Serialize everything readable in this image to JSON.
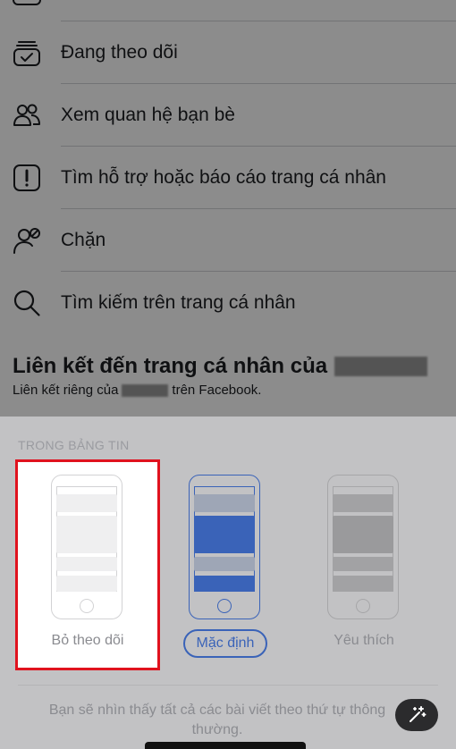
{
  "menu": {
    "items": [
      {
        "label": "Đang theo dõi",
        "icon": "following-icon"
      },
      {
        "label": "Xem quan hệ bạn bè",
        "icon": "friends-icon"
      },
      {
        "label": "Tìm hỗ trợ hoặc báo cáo trang cá nhân",
        "icon": "report-icon"
      },
      {
        "label": "Chặn",
        "icon": "block-user-icon"
      },
      {
        "label": "Tìm kiếm trên trang cá nhân",
        "icon": "search-icon"
      }
    ]
  },
  "link_section": {
    "title": "Liên kết đến trang cá nhân của",
    "subtitle_prefix": "Liên kết riêng của",
    "subtitle_suffix": "trên Facebook."
  },
  "sheet": {
    "section_label": "TRONG BẢNG TIN",
    "options": [
      {
        "label": "Bỏ theo dõi",
        "selected_box": true
      },
      {
        "label": "Mặc định",
        "current": true
      },
      {
        "label": "Yêu thích"
      }
    ],
    "footer_line1": "Bạn sẽ nhìn thấy tất cả các bài viết theo thứ tự thông",
    "footer_line2": "thường."
  },
  "colors": {
    "highlight_border": "#e0121e",
    "accent_blue": "#3a63b8"
  }
}
